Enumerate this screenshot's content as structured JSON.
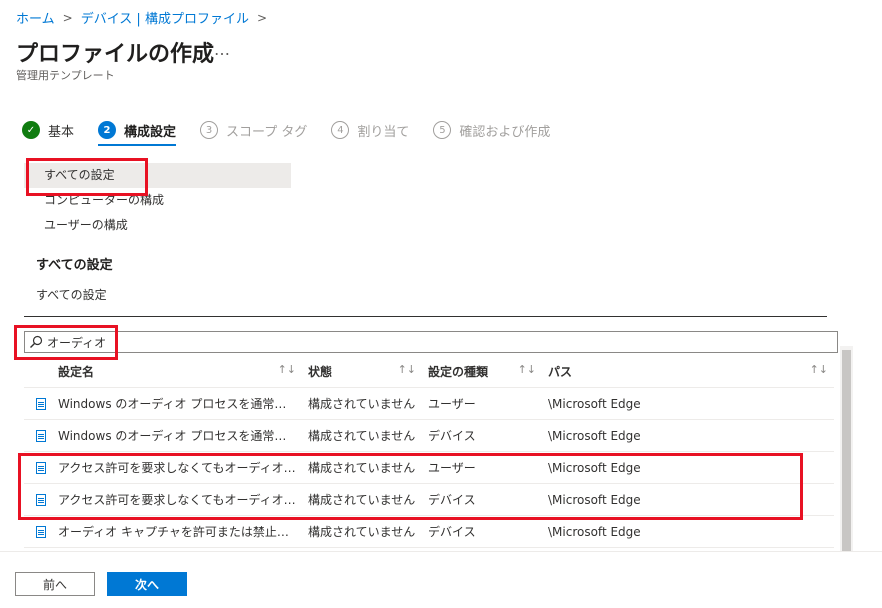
{
  "breadcrumb": {
    "home": "ホーム",
    "devices": "デバイス | 構成プロファイル"
  },
  "page": {
    "title": "プロファイルの作成",
    "more": "…",
    "subtitle": "管理用テンプレート"
  },
  "steps": [
    {
      "num": "✓",
      "label": "基本"
    },
    {
      "num": "2",
      "label": "構成設定"
    },
    {
      "num": "3",
      "label": "スコープ タグ"
    },
    {
      "num": "4",
      "label": "割り当て"
    },
    {
      "num": "5",
      "label": "確認および作成"
    }
  ],
  "nav": {
    "items": [
      "すべての設定",
      "コンピューターの構成",
      "ユーザーの構成"
    ],
    "heading": "すべての設定",
    "sub": "すべての設定"
  },
  "search": {
    "value": "オーディオ"
  },
  "table": {
    "headers": [
      "設定名",
      "状態",
      "設定の種類",
      "パス"
    ],
    "sort_glyph": "↑↓",
    "rows": [
      {
        "name": "Windows のオーディオ プロセスを通常より高...",
        "state": "構成されていません",
        "type": "ユーザー",
        "path": "\\Microsoft Edge"
      },
      {
        "name": "Windows のオーディオ プロセスを通常より高...",
        "state": "構成されていません",
        "type": "デバイス",
        "path": "\\Microsoft Edge"
      },
      {
        "name": "アクセス許可を要求しなくてもオーディオ キャプ...",
        "state": "構成されていません",
        "type": "ユーザー",
        "path": "\\Microsoft Edge"
      },
      {
        "name": "アクセス許可を要求しなくてもオーディオ キャプ...",
        "state": "構成されていません",
        "type": "デバイス",
        "path": "\\Microsoft Edge"
      },
      {
        "name": "オーディオ キャプチャを許可または禁止する",
        "state": "構成されていません",
        "type": "デバイス",
        "path": "\\Microsoft Edge"
      }
    ]
  },
  "footer": {
    "prev": "前へ",
    "next": "次へ"
  }
}
